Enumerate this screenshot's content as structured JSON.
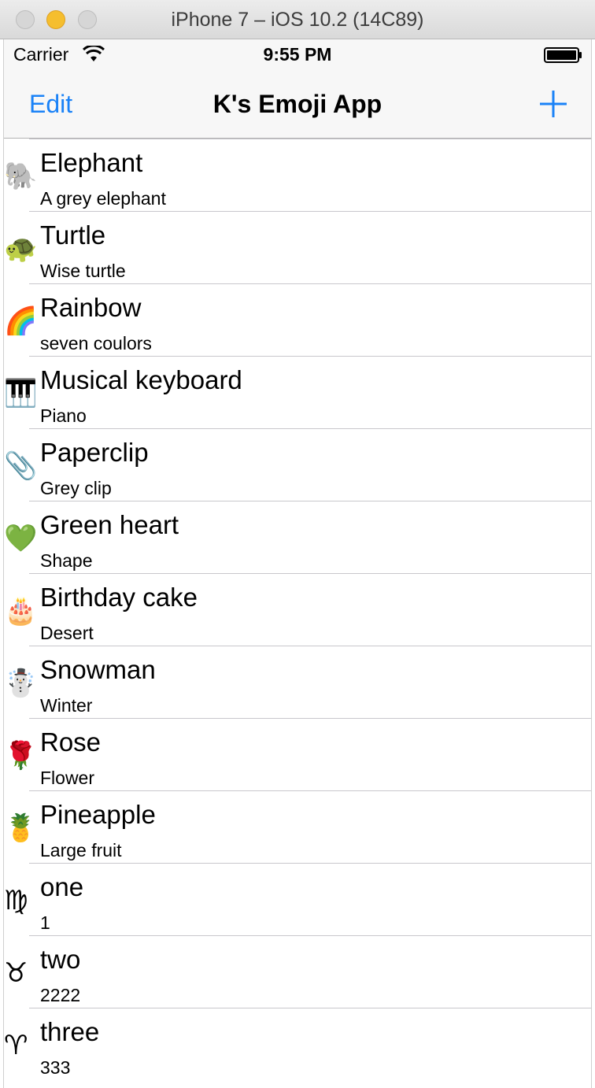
{
  "window": {
    "title": "iPhone 7 – iOS 10.2 (14C89)"
  },
  "statusbar": {
    "carrier": "Carrier",
    "time": "9:55 PM"
  },
  "navbar": {
    "edit_label": "Edit",
    "title": "K's Emoji App",
    "add_icon": "plus-icon"
  },
  "colors": {
    "tint": "#1a82f7",
    "separator": "#c8c7cc",
    "bar_background": "#f7f7f7"
  },
  "items": [
    {
      "emoji": "🐘",
      "title": "Elephant",
      "subtitle": "A grey elephant"
    },
    {
      "emoji": "🐢",
      "title": "Turtle",
      "subtitle": "Wise turtle"
    },
    {
      "emoji": "🌈",
      "title": "Rainbow",
      "subtitle": "seven coulors"
    },
    {
      "emoji": "🎹",
      "title": "Musical keyboard",
      "subtitle": "Piano"
    },
    {
      "emoji": "📎",
      "title": "Paperclip",
      "subtitle": "Grey clip"
    },
    {
      "emoji": "💚",
      "title": "Green heart",
      "subtitle": "Shape"
    },
    {
      "emoji": "🎂",
      "title": "Birthday cake",
      "subtitle": "Desert"
    },
    {
      "emoji": "☃️",
      "title": "Snowman",
      "subtitle": "Winter"
    },
    {
      "emoji": "🌹",
      "title": "Rose",
      "subtitle": "Flower"
    },
    {
      "emoji": "🍍",
      "title": "Pineapple",
      "subtitle": "Large fruit"
    },
    {
      "emoji": "♍",
      "title": "one",
      "subtitle": "1"
    },
    {
      "emoji": "♉",
      "title": "two",
      "subtitle": "2222"
    },
    {
      "emoji": "♈",
      "title": "three",
      "subtitle": "333"
    }
  ]
}
